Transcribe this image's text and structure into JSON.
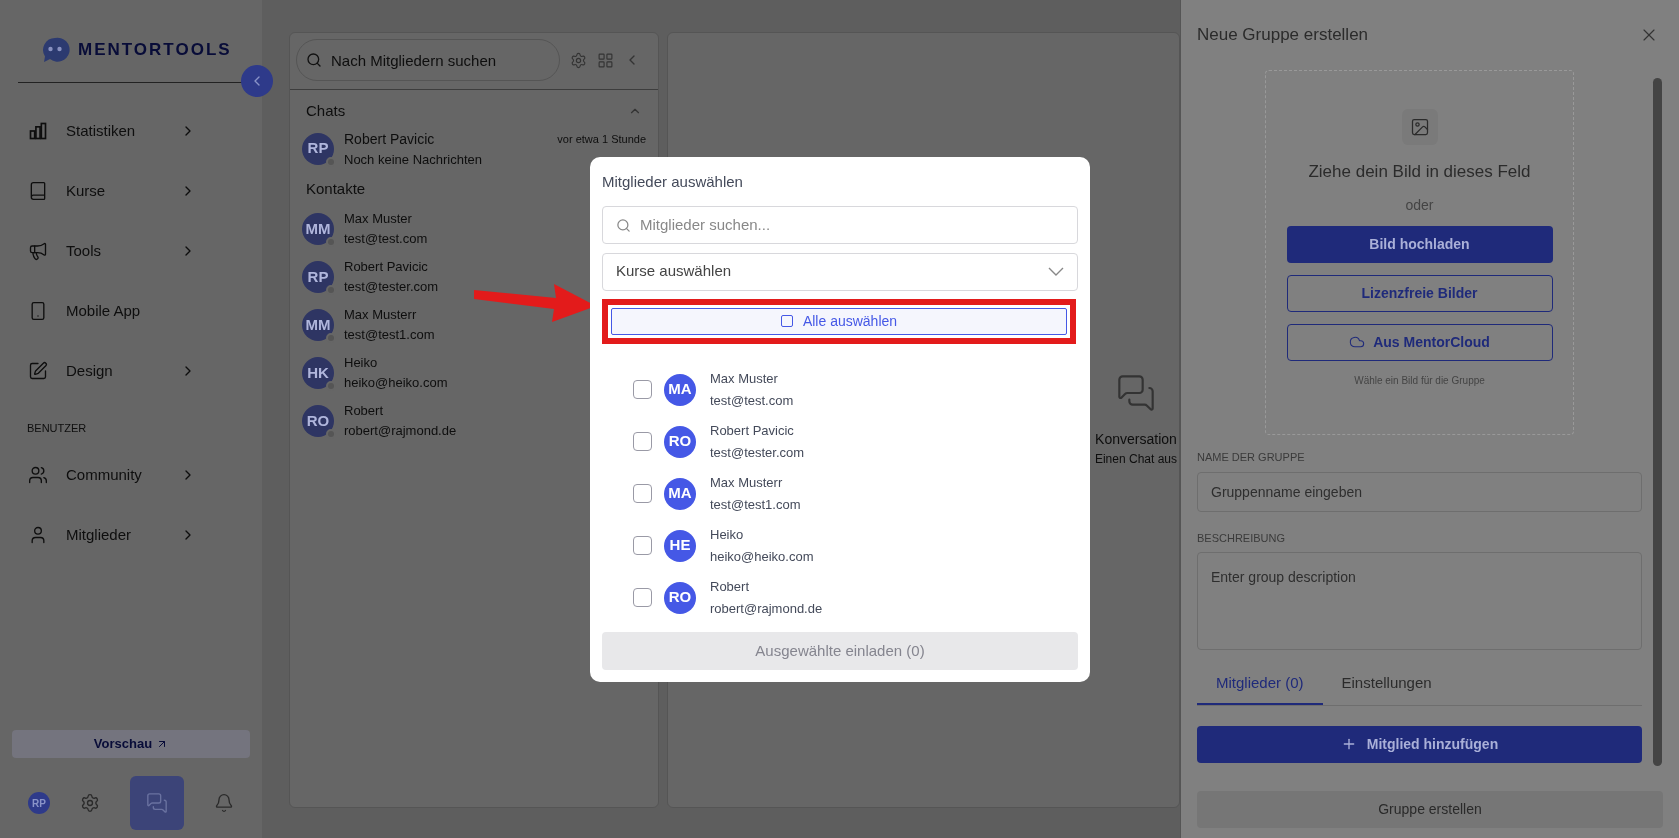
{
  "logo": {
    "text": "MENTORTOOLS"
  },
  "sidebar": {
    "items": [
      {
        "kind": "item",
        "label": "Statistiken",
        "chevron": true
      },
      {
        "kind": "item",
        "label": "Kurse",
        "chevron": true
      },
      {
        "kind": "item",
        "label": "Tools",
        "chevron": true
      },
      {
        "kind": "item",
        "label": "Mobile App",
        "chevron": false
      },
      {
        "kind": "item",
        "label": "Design",
        "chevron": true
      },
      {
        "kind": "section",
        "label": "BENUTZER"
      },
      {
        "kind": "item",
        "label": "Community",
        "chevron": true
      },
      {
        "kind": "item",
        "label": "Mitglieder",
        "chevron": true
      }
    ],
    "preview_button": "Vorschau",
    "user_initials": "RP"
  },
  "chat_panel": {
    "search_placeholder": "Nach Mitgliedern suchen",
    "chats_heading": "Chats",
    "chats": [
      {
        "initials": "RP",
        "name": "Robert Pavicic",
        "preview": "Noch keine Nachrichten",
        "time": "vor etwa 1 Stunde"
      }
    ],
    "contacts_heading": "Kontakte",
    "contacts": [
      {
        "initials": "MM",
        "name": "Max Muster",
        "email": "test@test.com"
      },
      {
        "initials": "RP",
        "name": "Robert Pavicic",
        "email": "test@tester.com"
      },
      {
        "initials": "MM",
        "name": "Max Musterr",
        "email": "test@test1.com"
      },
      {
        "initials": "HK",
        "name": "Heiko",
        "email": "heiko@heiko.com"
      },
      {
        "initials": "RO",
        "name": "Robert",
        "email": "robert@rajmond.de"
      }
    ]
  },
  "conversation_placeholder": {
    "title": "Konversation",
    "subtitle": "Einen Chat aus"
  },
  "modal": {
    "title": "Mitglieder auswählen",
    "search_placeholder": "Mitglieder suchen...",
    "course_select": "Kurse auswählen",
    "select_all": {
      "label": "Alle auswählen",
      "checked": false
    },
    "members": [
      {
        "initials": "MA",
        "name": "Max Muster",
        "email": "test@test.com",
        "checked": false
      },
      {
        "initials": "RO",
        "name": "Robert Pavicic",
        "email": "test@tester.com",
        "checked": false
      },
      {
        "initials": "MA",
        "name": "Max Musterr",
        "email": "test@test1.com",
        "checked": false
      },
      {
        "initials": "HE",
        "name": "Heiko",
        "email": "heiko@heiko.com",
        "checked": false
      },
      {
        "initials": "RO",
        "name": "Robert",
        "email": "robert@rajmond.de",
        "checked": false
      }
    ],
    "invite_button": {
      "label": "Ausgewählte einladen (0)",
      "disabled": true
    }
  },
  "group_panel": {
    "title": "Neue Gruppe erstellen",
    "dropzone": {
      "text": "Ziehe dein Bild in dieses Feld",
      "or": "oder",
      "upload": "Bild hochladen",
      "free_images": "Lizenzfreie Bilder",
      "cloud": "Aus MentorCloud",
      "hint": "Wähle ein Bild für die Gruppe"
    },
    "name_label": "NAME DER GRUPPE",
    "name_placeholder": "Gruppenname eingeben",
    "description_label": "BESCHREIBUNG",
    "description_placeholder": "Enter group description",
    "tabs": [
      {
        "label": "Mitglieder (0)",
        "selected": true
      },
      {
        "label": "Einstellungen",
        "selected": false
      }
    ],
    "add_member": "Mitglied hinzufügen",
    "create_button": {
      "label": "Gruppe erstellen",
      "disabled": true
    }
  }
}
